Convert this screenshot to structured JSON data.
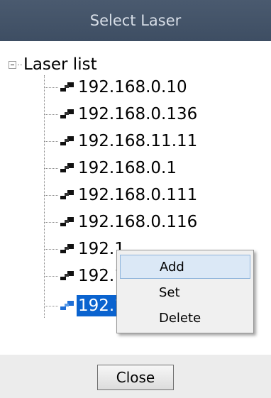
{
  "window": {
    "title": "Select Laser"
  },
  "tree": {
    "root_label": "Laser list",
    "items": [
      {
        "label": "192.168.0.10"
      },
      {
        "label": "192.168.0.136"
      },
      {
        "label": "192.168.11.11"
      },
      {
        "label": "192.168.0.1"
      },
      {
        "label": "192.168.0.111"
      },
      {
        "label": "192.168.0.116"
      },
      {
        "label": "192.1"
      },
      {
        "label": "192.1"
      },
      {
        "label": "192.1",
        "selected": true
      }
    ]
  },
  "context_menu": {
    "items": [
      {
        "label": "Add",
        "hovered": true
      },
      {
        "label": "Set"
      },
      {
        "label": "Delete"
      }
    ]
  },
  "footer": {
    "close_label": "Close"
  },
  "colors": {
    "titlebar": "#3e4e63",
    "selection": "#0a63cf",
    "menu_hover": "#dbe8f6"
  },
  "icons": {
    "node": "network-node-icon",
    "expander": "collapse-minus-icon"
  }
}
